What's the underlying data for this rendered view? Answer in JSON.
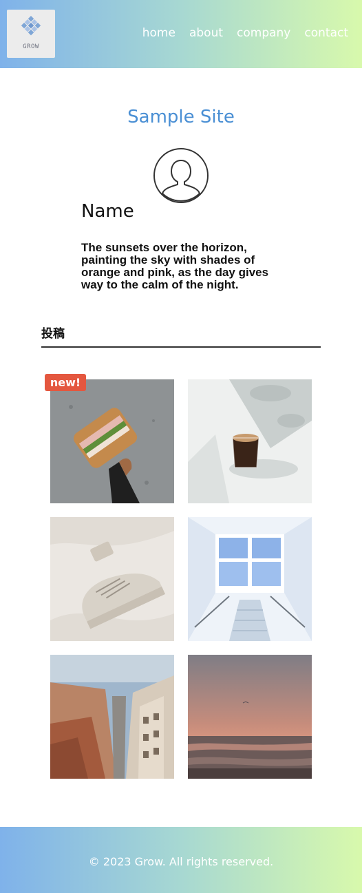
{
  "header": {
    "logo_text": "GROW",
    "nav": [
      "home",
      "about",
      "company",
      "contact"
    ]
  },
  "profile": {
    "site_title": "Sample Site",
    "name": "Name",
    "bio": "The sunsets over the horizon, painting the sky with shades of orange and pink, as the day gives way to the calm of the night."
  },
  "posts": {
    "heading": "投稿",
    "badge": "new!",
    "images": [
      "sandwich-photo",
      "coffee-photo",
      "sneaker-photo",
      "staircase-photo",
      "street-photo",
      "beach-sunset-photo"
    ]
  },
  "footer": {
    "copyright": "© 2023 Grow. All rights reserved."
  },
  "colors": {
    "gradient_start": "#7fb2ea",
    "gradient_end": "#d8f9ac",
    "title": "#4a8fd4",
    "badge": "#e4573f"
  }
}
